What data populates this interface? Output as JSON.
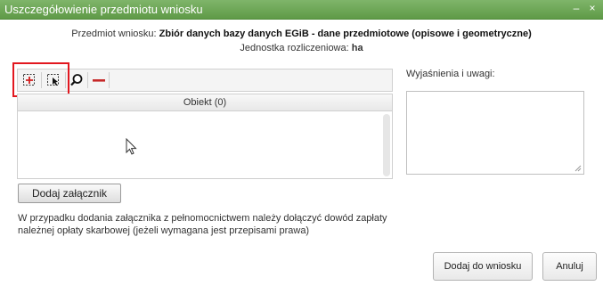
{
  "dialog": {
    "title": "Uszczegółowienie przedmiotu wniosku",
    "subject_label": "Przedmiot wniosku:",
    "subject_value": "Zbiór danych bazy danych EGiB - dane przedmiotowe (opisowe i geometryczne)",
    "unit_label": "Jednostka rozliczeniowa:",
    "unit_value": "ha"
  },
  "toolbar": {
    "icons": [
      "add-object-icon",
      "select-object-icon",
      "search-icon",
      "remove-icon"
    ],
    "highlight_color": "#e2171f"
  },
  "grid": {
    "header": "Obiekt (0)"
  },
  "attach": {
    "button": "Dodaj załącznik",
    "note_line1": "W przypadku dodania załącznika z pełnomocnictwem należy dołączyć dowód zapłaty",
    "note_line2": "należnej opłaty skarbowej (jeżeli wymagana jest przepisami prawa)"
  },
  "remarks": {
    "label": "Wyjaśnienia i uwagi:",
    "value": ""
  },
  "footer": {
    "add_button": "Dodaj do wniosku",
    "cancel_button": "Anuluj"
  },
  "colors": {
    "titlebar": "#6aa650",
    "remove_icon": "#c62828"
  }
}
